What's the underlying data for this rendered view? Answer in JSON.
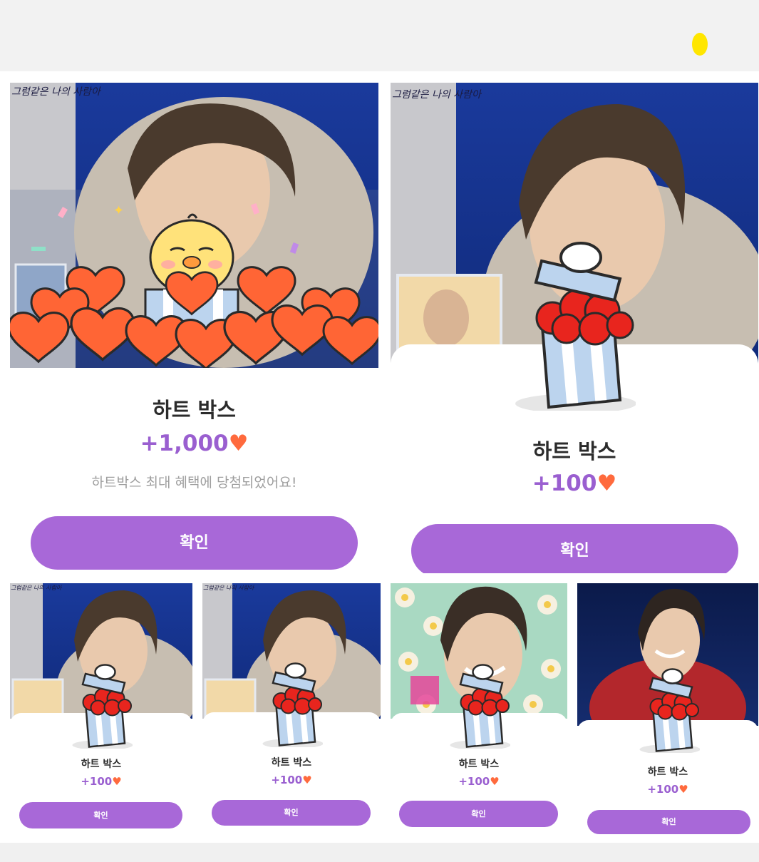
{
  "cards": [
    {
      "photo_caption": "그럼같은 나의 사람아",
      "title": "하트 박스",
      "amount": "+1,000",
      "description": "하트박스 최대 혜택에 당첨되었어요!",
      "button": "확인"
    },
    {
      "photo_caption": "그럼같은 나의 사람아",
      "title": "하트 박스",
      "amount": "+100",
      "button": "확인"
    },
    {
      "photo_caption": "그럼같은 나의 사람아",
      "title": "하트 박스",
      "amount": "+100",
      "button": "확인"
    },
    {
      "photo_caption": "그럼같은 나의 사람아",
      "title": "하트 박스",
      "amount": "+100",
      "button": "확인"
    },
    {
      "title": "하트 박스",
      "amount": "+100",
      "button": "확인"
    },
    {
      "title": "하트 박스",
      "amount": "+100",
      "button": "확인"
    }
  ],
  "colors": {
    "accent": "#a868d8",
    "amount": "#9a5fd0",
    "heart": "#ff6a3d",
    "photo_bg": "#12308a",
    "notification_dot": "#ffe600"
  },
  "icons": {
    "heart": "heart-icon",
    "gift": "gift-box-icon",
    "mascot": "chick-mascot-icon"
  }
}
